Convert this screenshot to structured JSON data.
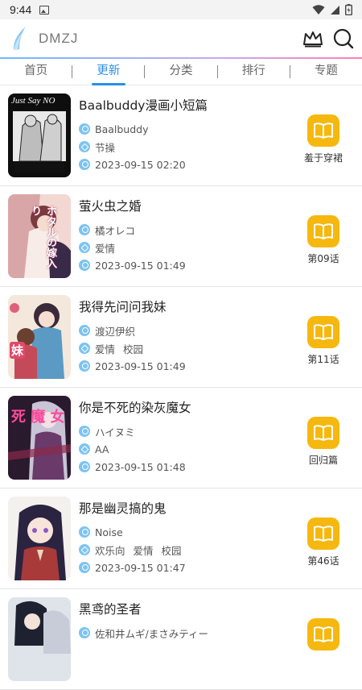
{
  "status_bar": {
    "time": "9:44"
  },
  "header": {
    "app_title": "DMZJ"
  },
  "tabs": [
    {
      "label": "首页",
      "active": false
    },
    {
      "label": "更新",
      "active": true
    },
    {
      "label": "分类",
      "active": false
    },
    {
      "label": "排行",
      "active": false
    },
    {
      "label": "专题",
      "active": false
    }
  ],
  "colors": {
    "accent": "#2b8fe6",
    "read_button": "#f6b80f",
    "meta_icon": "#7cc3f2"
  },
  "comics": [
    {
      "title": "Baalbuddy漫画小短篇",
      "author": "Baalbuddy",
      "tags": [
        "节操"
      ],
      "updated": "2023-09-15 02:20",
      "chapter": "羞于穿裙",
      "cover_text": "Just Say NO"
    },
    {
      "title": "萤火虫之婚",
      "author": "橘オレコ",
      "tags": [
        "爱情"
      ],
      "updated": "2023-09-15 01:49",
      "chapter": "第09话",
      "cover_text": "ホタルの嫁入り"
    },
    {
      "title": "我得先问问我妹",
      "author": "渡辺伊织",
      "tags": [
        "爱情",
        "校园"
      ],
      "updated": "2023-09-15 01:49",
      "chapter": "第11话",
      "cover_text": "妹"
    },
    {
      "title": "你是不死的染灰魔女",
      "author": "ハイヌミ",
      "tags": [
        "AA"
      ],
      "updated": "2023-09-15 01:48",
      "chapter": "回归篇",
      "cover_text": "死 魔 女"
    },
    {
      "title": "那是幽灵搞的鬼",
      "author": "Noise",
      "tags": [
        "欢乐向",
        "爱情",
        "校园"
      ],
      "updated": "2023-09-15 01:47",
      "chapter": "第46话",
      "cover_text": ""
    },
    {
      "title": "黑鸢的圣者",
      "author": "佐和井ムギ/まさみティー",
      "tags": [],
      "updated": "",
      "chapter": "",
      "cover_text": ""
    }
  ]
}
